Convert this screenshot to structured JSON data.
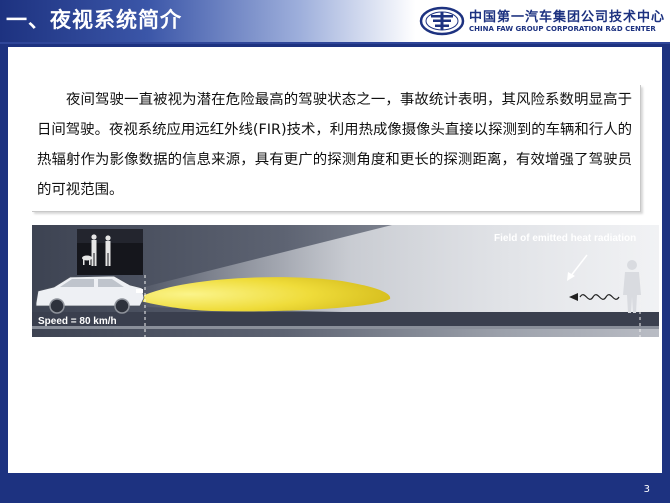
{
  "header": {
    "title": "一、夜视系统简介",
    "org_cn": "中国第一汽车集团公司技术中心",
    "org_en": "CHINA FAW GROUP CORPORATION R&D CENTER",
    "logo_icon": "faw-logo"
  },
  "intro": {
    "paragraph": "夜间驾驶一直被视为潜在危险最高的驾驶状态之一，事故统计表明，其风险系数明显高于日间驾驶。夜视系统应用远红外线(FIR)技术，利用热成像摄像头直接以探测到的车辆和行人的热辐射作为影像数据的信息来源，具有更广的探测角度和更长的探测距离，有效增强了驾驶员的可视范围。"
  },
  "illustration": {
    "heat_label": "Field of emitted heat radiation",
    "speed_label": "Speed = 80 km/h"
  },
  "footer": {
    "page_number": "3"
  },
  "colors": {
    "brand_blue": "#1d3280",
    "headlight_yellow": "#f0e040",
    "road_dark": "#3a3f4e"
  }
}
